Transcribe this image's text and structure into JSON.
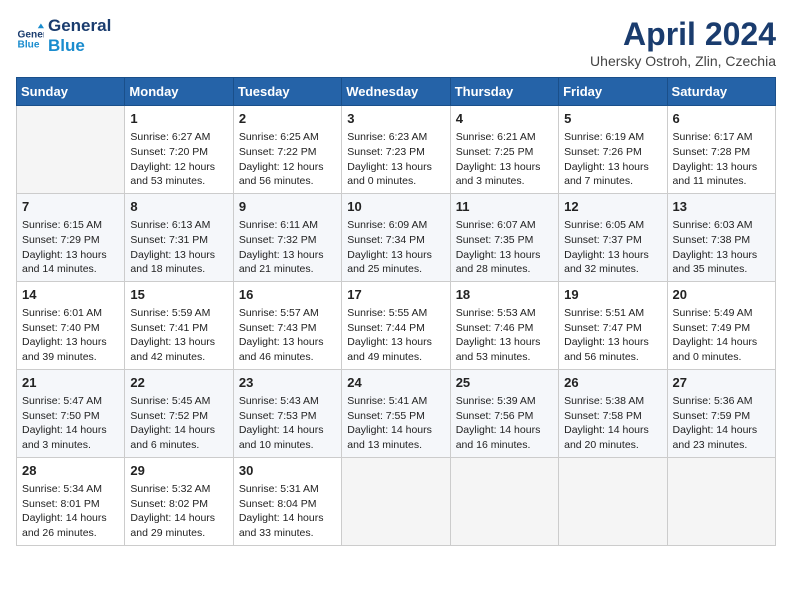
{
  "logo": {
    "line1": "General",
    "line2": "Blue"
  },
  "title": "April 2024",
  "subtitle": "Uhersky Ostroh, Zlin, Czechia",
  "days_of_week": [
    "Sunday",
    "Monday",
    "Tuesday",
    "Wednesday",
    "Thursday",
    "Friday",
    "Saturday"
  ],
  "weeks": [
    [
      {
        "day": "",
        "info": ""
      },
      {
        "day": "1",
        "info": "Sunrise: 6:27 AM\nSunset: 7:20 PM\nDaylight: 12 hours\nand 53 minutes."
      },
      {
        "day": "2",
        "info": "Sunrise: 6:25 AM\nSunset: 7:22 PM\nDaylight: 12 hours\nand 56 minutes."
      },
      {
        "day": "3",
        "info": "Sunrise: 6:23 AM\nSunset: 7:23 PM\nDaylight: 13 hours\nand 0 minutes."
      },
      {
        "day": "4",
        "info": "Sunrise: 6:21 AM\nSunset: 7:25 PM\nDaylight: 13 hours\nand 3 minutes."
      },
      {
        "day": "5",
        "info": "Sunrise: 6:19 AM\nSunset: 7:26 PM\nDaylight: 13 hours\nand 7 minutes."
      },
      {
        "day": "6",
        "info": "Sunrise: 6:17 AM\nSunset: 7:28 PM\nDaylight: 13 hours\nand 11 minutes."
      }
    ],
    [
      {
        "day": "7",
        "info": "Sunrise: 6:15 AM\nSunset: 7:29 PM\nDaylight: 13 hours\nand 14 minutes."
      },
      {
        "day": "8",
        "info": "Sunrise: 6:13 AM\nSunset: 7:31 PM\nDaylight: 13 hours\nand 18 minutes."
      },
      {
        "day": "9",
        "info": "Sunrise: 6:11 AM\nSunset: 7:32 PM\nDaylight: 13 hours\nand 21 minutes."
      },
      {
        "day": "10",
        "info": "Sunrise: 6:09 AM\nSunset: 7:34 PM\nDaylight: 13 hours\nand 25 minutes."
      },
      {
        "day": "11",
        "info": "Sunrise: 6:07 AM\nSunset: 7:35 PM\nDaylight: 13 hours\nand 28 minutes."
      },
      {
        "day": "12",
        "info": "Sunrise: 6:05 AM\nSunset: 7:37 PM\nDaylight: 13 hours\nand 32 minutes."
      },
      {
        "day": "13",
        "info": "Sunrise: 6:03 AM\nSunset: 7:38 PM\nDaylight: 13 hours\nand 35 minutes."
      }
    ],
    [
      {
        "day": "14",
        "info": "Sunrise: 6:01 AM\nSunset: 7:40 PM\nDaylight: 13 hours\nand 39 minutes."
      },
      {
        "day": "15",
        "info": "Sunrise: 5:59 AM\nSunset: 7:41 PM\nDaylight: 13 hours\nand 42 minutes."
      },
      {
        "day": "16",
        "info": "Sunrise: 5:57 AM\nSunset: 7:43 PM\nDaylight: 13 hours\nand 46 minutes."
      },
      {
        "day": "17",
        "info": "Sunrise: 5:55 AM\nSunset: 7:44 PM\nDaylight: 13 hours\nand 49 minutes."
      },
      {
        "day": "18",
        "info": "Sunrise: 5:53 AM\nSunset: 7:46 PM\nDaylight: 13 hours\nand 53 minutes."
      },
      {
        "day": "19",
        "info": "Sunrise: 5:51 AM\nSunset: 7:47 PM\nDaylight: 13 hours\nand 56 minutes."
      },
      {
        "day": "20",
        "info": "Sunrise: 5:49 AM\nSunset: 7:49 PM\nDaylight: 14 hours\nand 0 minutes."
      }
    ],
    [
      {
        "day": "21",
        "info": "Sunrise: 5:47 AM\nSunset: 7:50 PM\nDaylight: 14 hours\nand 3 minutes."
      },
      {
        "day": "22",
        "info": "Sunrise: 5:45 AM\nSunset: 7:52 PM\nDaylight: 14 hours\nand 6 minutes."
      },
      {
        "day": "23",
        "info": "Sunrise: 5:43 AM\nSunset: 7:53 PM\nDaylight: 14 hours\nand 10 minutes."
      },
      {
        "day": "24",
        "info": "Sunrise: 5:41 AM\nSunset: 7:55 PM\nDaylight: 14 hours\nand 13 minutes."
      },
      {
        "day": "25",
        "info": "Sunrise: 5:39 AM\nSunset: 7:56 PM\nDaylight: 14 hours\nand 16 minutes."
      },
      {
        "day": "26",
        "info": "Sunrise: 5:38 AM\nSunset: 7:58 PM\nDaylight: 14 hours\nand 20 minutes."
      },
      {
        "day": "27",
        "info": "Sunrise: 5:36 AM\nSunset: 7:59 PM\nDaylight: 14 hours\nand 23 minutes."
      }
    ],
    [
      {
        "day": "28",
        "info": "Sunrise: 5:34 AM\nSunset: 8:01 PM\nDaylight: 14 hours\nand 26 minutes."
      },
      {
        "day": "29",
        "info": "Sunrise: 5:32 AM\nSunset: 8:02 PM\nDaylight: 14 hours\nand 29 minutes."
      },
      {
        "day": "30",
        "info": "Sunrise: 5:31 AM\nSunset: 8:04 PM\nDaylight: 14 hours\nand 33 minutes."
      },
      {
        "day": "",
        "info": ""
      },
      {
        "day": "",
        "info": ""
      },
      {
        "day": "",
        "info": ""
      },
      {
        "day": "",
        "info": ""
      }
    ]
  ]
}
